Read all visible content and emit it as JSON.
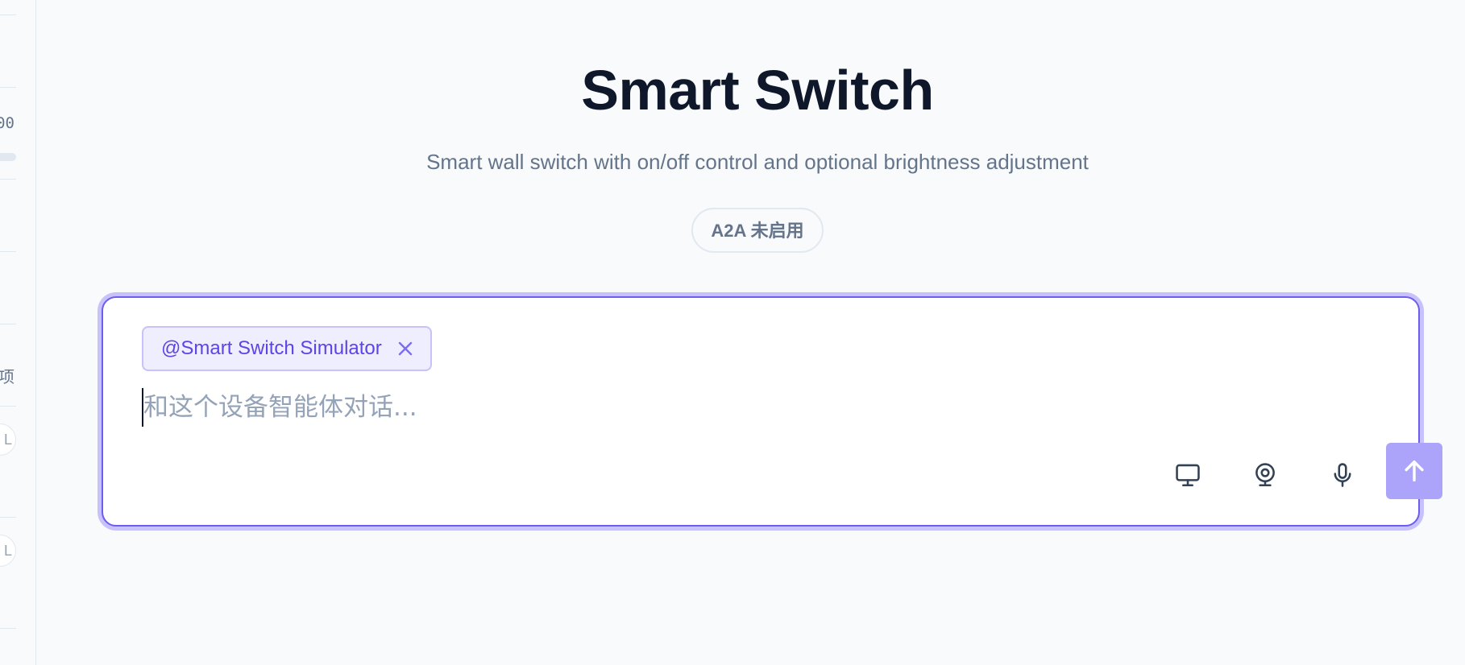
{
  "sidebar": {
    "fragment_number": "00",
    "fragment_label": "项",
    "fragment_pill_1": "L",
    "fragment_pill_2": "L"
  },
  "header": {
    "title": "Smart Switch",
    "subtitle": "Smart wall switch with on/off control and optional brightness adjustment",
    "badge": "A2A 未启用"
  },
  "composer": {
    "mention": "@Smart Switch Simulator",
    "placeholder": "和这个设备智能体对话...",
    "value": "",
    "tools": [
      {
        "name": "screen-share",
        "icon": "monitor-icon"
      },
      {
        "name": "camera",
        "icon": "webcam-icon"
      },
      {
        "name": "voice",
        "icon": "microphone-icon"
      }
    ],
    "send_icon": "arrow-up-icon"
  },
  "colors": {
    "accent": "#6d5cf0",
    "accent_light": "#c7c2fb",
    "send_button": "#aba4fa",
    "title": "#0f172a",
    "muted": "#64748b"
  }
}
